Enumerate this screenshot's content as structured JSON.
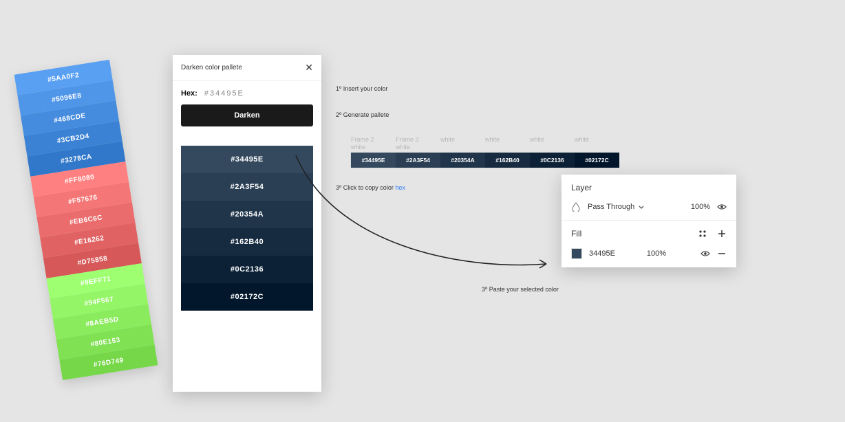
{
  "side_palette": [
    {
      "hex": "#5AA0F2",
      "bg": "#5AA0F2"
    },
    {
      "hex": "#5096E8",
      "bg": "#5096E8"
    },
    {
      "hex": "#468CDE",
      "bg": "#468CDE"
    },
    {
      "hex": "#3CB2D4",
      "bg": "#3C82D4"
    },
    {
      "hex": "#3278CA",
      "bg": "#3278CA"
    },
    {
      "hex": "#FF8080",
      "bg": "#FF8080"
    },
    {
      "hex": "#F57676",
      "bg": "#F57676"
    },
    {
      "hex": "#EB6C6C",
      "bg": "#EB6C6C"
    },
    {
      "hex": "#E16262",
      "bg": "#E16262"
    },
    {
      "hex": "#D75858",
      "bg": "#D75858"
    },
    {
      "hex": "#9EFF71",
      "bg": "#9EFF71"
    },
    {
      "hex": "#94F567",
      "bg": "#94F567"
    },
    {
      "hex": "#8AEB5D",
      "bg": "#8AEB5D"
    },
    {
      "hex": "#80E153",
      "bg": "#80E153"
    },
    {
      "hex": "#76D749",
      "bg": "#76D749"
    }
  ],
  "panel": {
    "title": "Darken color pallete",
    "hex_label": "Hex:",
    "hex_value": "#34495E",
    "button": "Darken",
    "results": [
      {
        "hex": "#34495E",
        "bg": "#34495E"
      },
      {
        "hex": "#2A3F54",
        "bg": "#2A3F54"
      },
      {
        "hex": "#20354A",
        "bg": "#20354A"
      },
      {
        "hex": "#162B40",
        "bg": "#162B40"
      },
      {
        "hex": "#0C2136",
        "bg": "#0C2136"
      },
      {
        "hex": "#02172C",
        "bg": "#02172C"
      }
    ]
  },
  "steps": {
    "s1": "1º Insert your color",
    "s2": "2º Generate pallete",
    "s3a": "3º Click to copy color ",
    "s3b": "hex",
    "s3c": "3º Paste your selected color"
  },
  "frames": {
    "labels": [
      {
        "line1": "Frame 2",
        "line2": "white"
      },
      {
        "line1": "Frame 3",
        "line2": "white"
      },
      {
        "line1": "",
        "line2": "white"
      },
      {
        "line1": "",
        "line2": "white"
      },
      {
        "line1": "",
        "line2": "white"
      },
      {
        "line1": "",
        "line2": "white"
      }
    ],
    "cells": [
      {
        "hex": "#34495E",
        "bg": "#34495E"
      },
      {
        "hex": "#2A3F54",
        "bg": "#2A3F54"
      },
      {
        "hex": "#20354A",
        "bg": "#20354A"
      },
      {
        "hex": "#162B40",
        "bg": "#162B40"
      },
      {
        "hex": "#0C2136",
        "bg": "#0C2136"
      },
      {
        "hex": "#02172C",
        "bg": "#02172C"
      }
    ]
  },
  "layer_panel": {
    "layer_title": "Layer",
    "blend_mode": "Pass Through",
    "layer_opacity": "100%",
    "fill_title": "Fill",
    "fill_hex": "34495E",
    "fill_opacity": "100%"
  }
}
